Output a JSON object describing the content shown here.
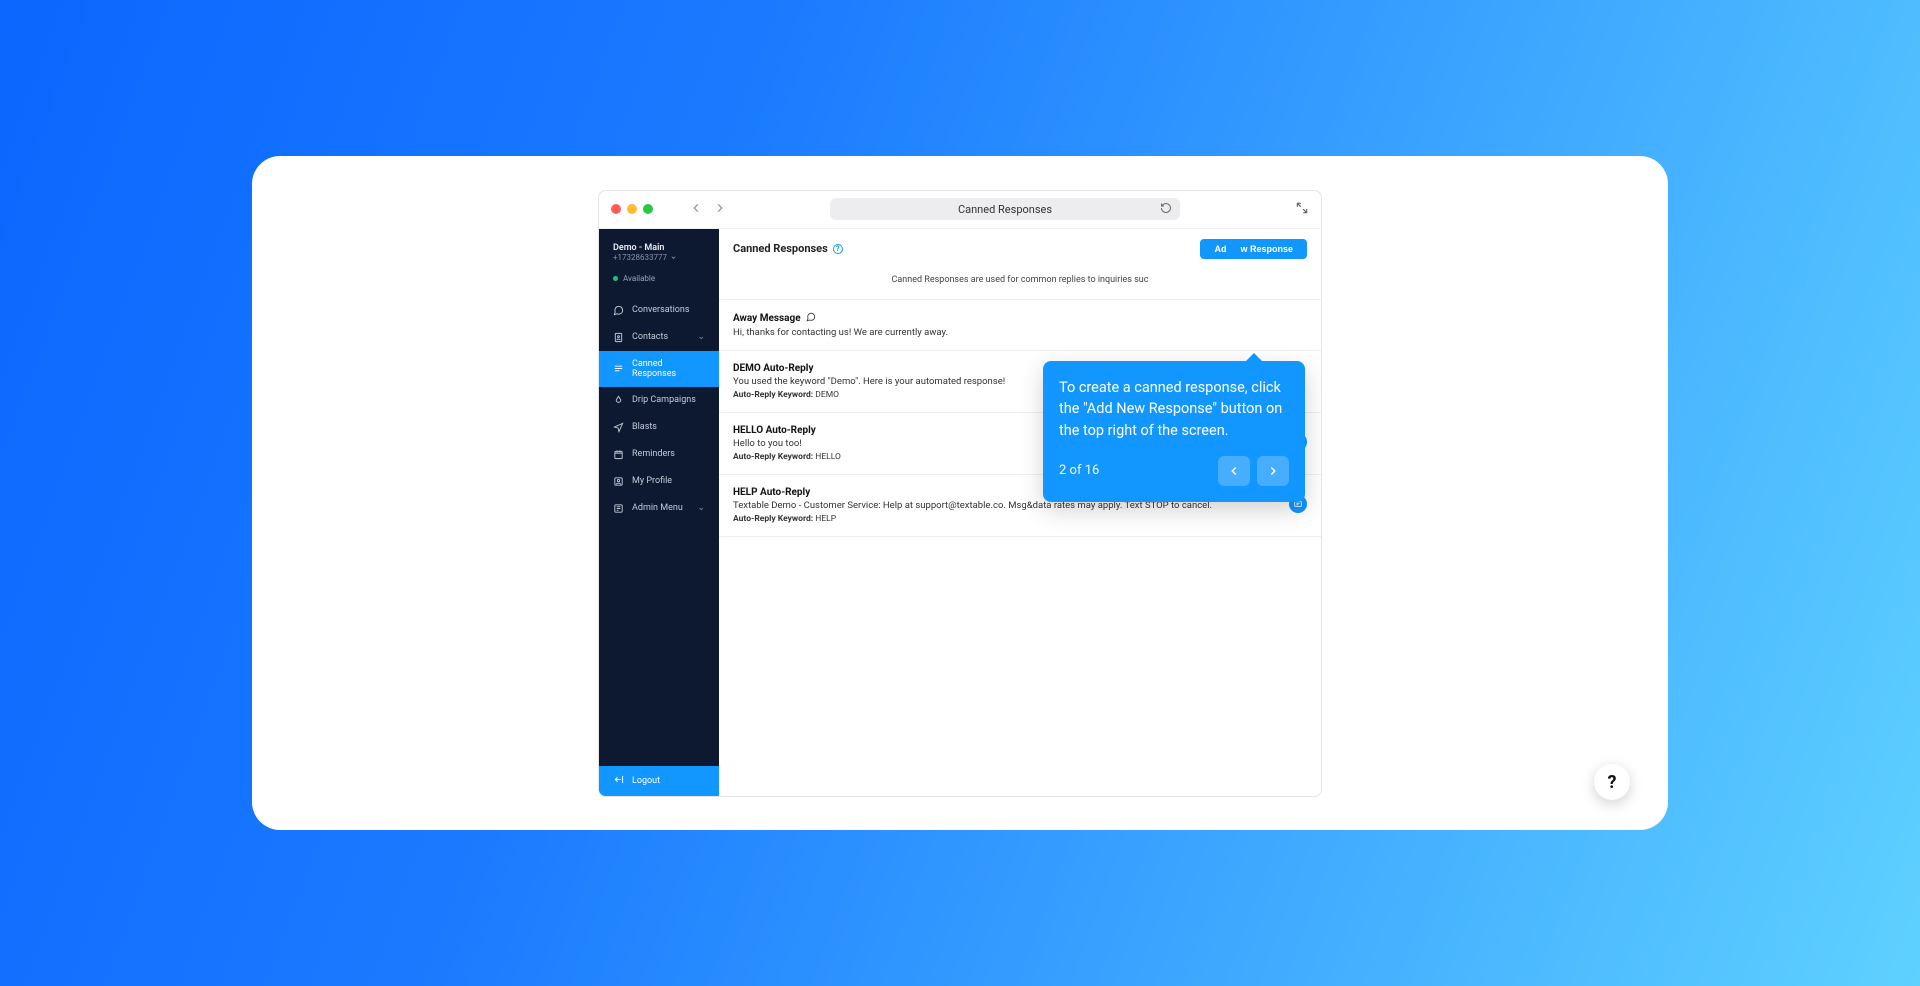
{
  "browser": {
    "title": "Canned Responses"
  },
  "sidebar": {
    "account_name": "Demo - Main",
    "phone": "+17328633777",
    "status": "Available",
    "items": [
      {
        "label": "Conversations"
      },
      {
        "label": "Contacts"
      },
      {
        "label": "Canned Responses"
      },
      {
        "label": "Drip Campaigns"
      },
      {
        "label": "Blasts"
      },
      {
        "label": "Reminders"
      },
      {
        "label": "My Profile"
      },
      {
        "label": "Admin Menu"
      }
    ],
    "logout": "Logout"
  },
  "main": {
    "title": "Canned Responses",
    "add_button_left": "Ad",
    "add_button_right": "w Response",
    "description": "Canned Responses are used for common replies to inquiries suc",
    "rows": [
      {
        "title": "Away Message",
        "body": "Hi, thanks for contacting us! We are currently away.",
        "kw_label": "",
        "kw_value": "",
        "show_icon_bubble": true,
        "show_badge": false
      },
      {
        "title": "DEMO Auto-Reply",
        "body": "You used the keyword \"Demo\". Here is your automated response!",
        "kw_label": "Auto-Reply Keyword:",
        "kw_value": "DEMO",
        "show_badge": false
      },
      {
        "title": "HELLO Auto-Reply",
        "body": "Hello to you too!",
        "kw_label": "Auto-Reply Keyword:",
        "kw_value": "HELLO",
        "show_badge": true
      },
      {
        "title": "HELP Auto-Reply",
        "body": "Textable Demo - Customer Service: Help at support@textable.co. Msg&data rates may apply. Text STOP to cancel.",
        "kw_label": "Auto-Reply Keyword:",
        "kw_value": "HELP",
        "show_badge": true
      }
    ]
  },
  "tooltip": {
    "text": "To create a canned response, click the \"Add New Response\" button on the top right of the screen.",
    "step": "2 of 16"
  },
  "fab": {
    "label": "?"
  }
}
